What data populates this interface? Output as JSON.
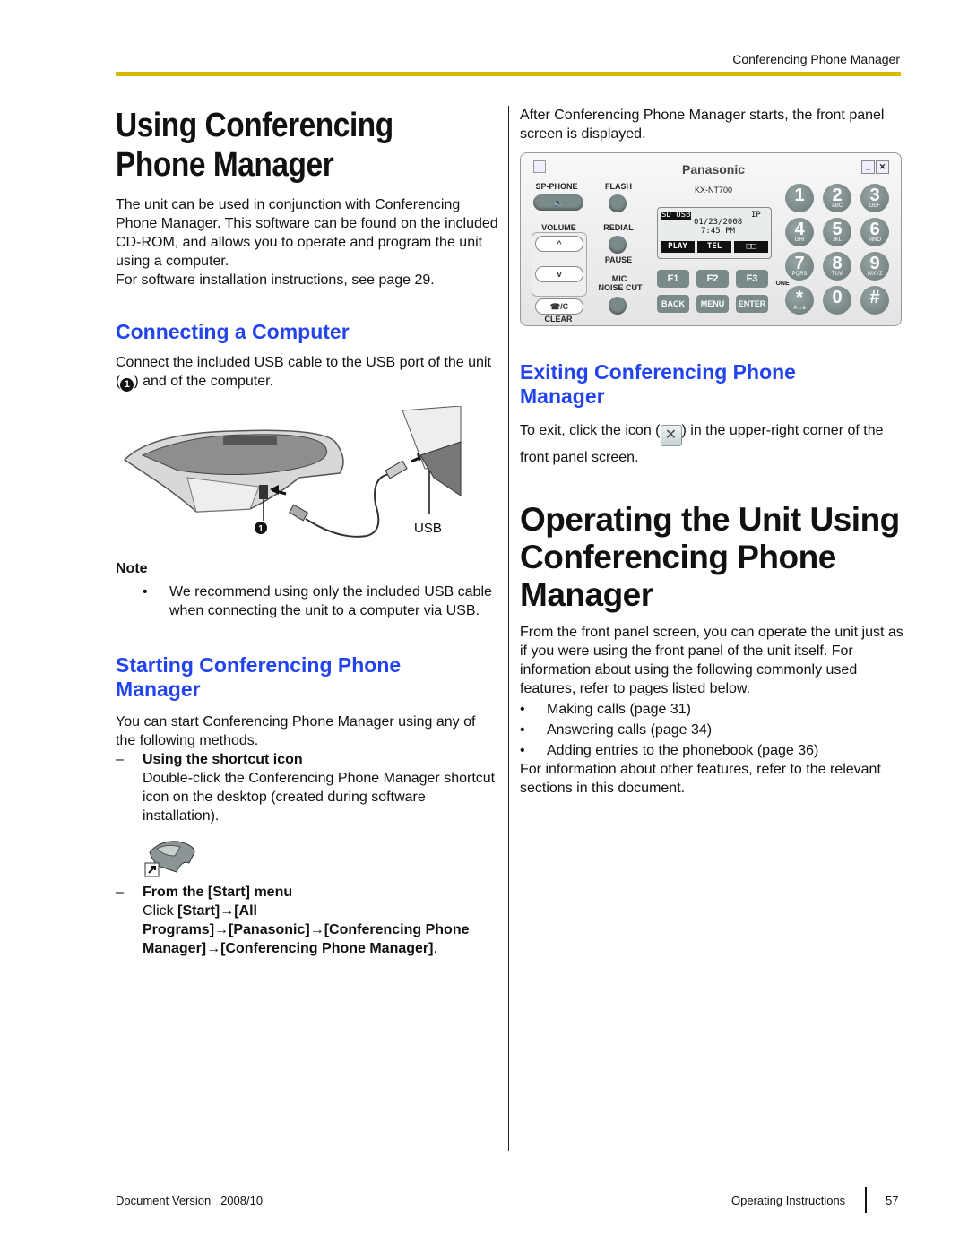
{
  "header": {
    "running_title": "Conferencing Phone Manager"
  },
  "left": {
    "title_line1": "Using Conferencing",
    "title_line2": "Phone Manager",
    "intro": "The unit can be used in conjunction with Conferencing Phone Manager. This software can be found on the included CD-ROM, and allows you to operate and program the unit using a computer.",
    "install_ref": "For software installation instructions, see page 29.",
    "connecting": {
      "heading": "Connecting a Computer",
      "text_before": "Connect the included USB cable to the USB port of the unit (",
      "callout": "1",
      "text_after": ") and of the computer.",
      "figure_label_usb": "USB",
      "figure_callout": "1"
    },
    "note": {
      "label": "Note",
      "bullets": [
        "We recommend using only the included USB cable when connecting the unit to a computer via USB."
      ]
    },
    "starting": {
      "heading_line1": "Starting Conferencing Phone",
      "heading_line2": "Manager",
      "intro": "You can start Conferencing Phone Manager using any of the following methods.",
      "method1_title": "Using the shortcut icon",
      "method1_text": "Double-click the Conferencing Phone Manager shortcut icon on the desktop (created during software installation).",
      "method2_title": "From the [Start] menu",
      "method2_click": "Click ",
      "method2_path": "[Start]→[All Programs]→[Panasonic]→[Conferencing Phone Manager]→[Conferencing Phone Manager]",
      "method2_end": "."
    }
  },
  "right": {
    "panel_intro": "After Conferencing Phone Manager starts, the front panel screen is displayed.",
    "panel": {
      "brand": "Panasonic",
      "model": "KX-NT700",
      "sp_phone": "SP-PHONE",
      "flash": "FLASH",
      "volume": "VOLUME",
      "redial": "REDIAL",
      "pause": "PAUSE",
      "mic_line1": "MIC",
      "mic_line2": "NOISE CUT",
      "clear_btn": "☎/C",
      "clear": "CLEAR",
      "lcd_status": "SD USB",
      "lcd_ip": "IP",
      "lcd_date": "01/23/2008",
      "lcd_time": "7:45 PM",
      "soft_keys": [
        "PLAY",
        "TEL",
        "□□"
      ],
      "f_keys": [
        "F1",
        "F2",
        "F3"
      ],
      "nav_keys": [
        "BACK",
        "MENU",
        "ENTER"
      ],
      "tone": "TONE",
      "keypad": [
        {
          "d": "1",
          "s": ""
        },
        {
          "d": "2",
          "s": "ABC"
        },
        {
          "d": "3",
          "s": "DEF"
        },
        {
          "d": "4",
          "s": "GHI"
        },
        {
          "d": "5",
          "s": "JKL"
        },
        {
          "d": "6",
          "s": "MNO"
        },
        {
          "d": "7",
          "s": "PQRS"
        },
        {
          "d": "8",
          "s": "TUV"
        },
        {
          "d": "9",
          "s": "WXYZ"
        },
        {
          "d": "*",
          "s": "A↔a"
        },
        {
          "d": "0",
          "s": ""
        },
        {
          "d": "#",
          "s": ""
        }
      ]
    },
    "exiting": {
      "heading_line1": "Exiting Conferencing Phone",
      "heading_line2": "Manager",
      "text_before": "To exit, click the icon (",
      "icon": "✕",
      "text_after": ") in the upper-right corner of the front panel screen."
    },
    "operating": {
      "title_line1": "Operating the Unit Using",
      "title_line2": "Conferencing Phone",
      "title_line3": "Manager",
      "intro": "From the front panel screen, you can operate the unit just as if you were using the front panel of the unit itself. For information about using the following commonly used features, refer to pages listed below.",
      "bullets": [
        "Making calls (page 31)",
        "Answering calls (page 34)",
        "Adding entries to the phonebook (page 36)"
      ],
      "outro": "For information about other features, refer to the relevant sections in this document."
    }
  },
  "footer": {
    "doc_version_label": "Document Version",
    "doc_version": "2008/10",
    "manual": "Operating Instructions",
    "page": "57"
  }
}
